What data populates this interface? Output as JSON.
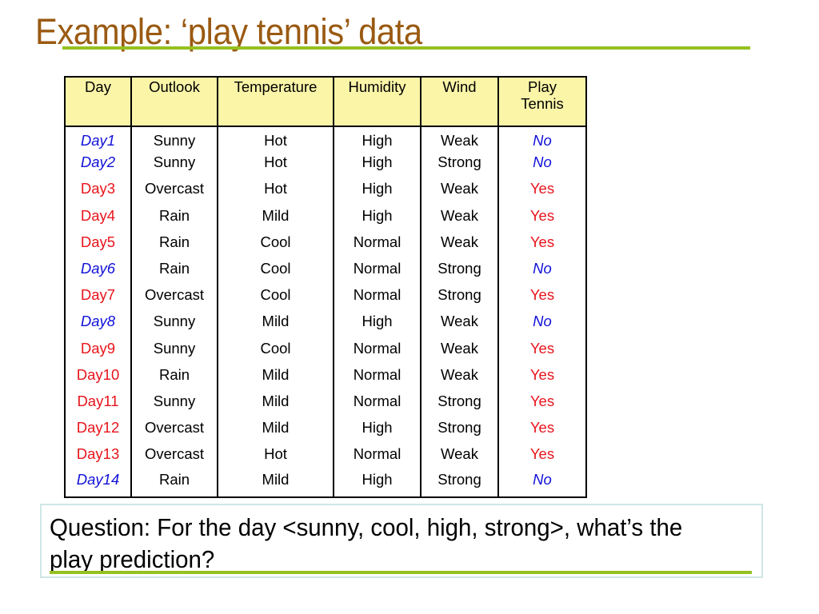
{
  "slide": {
    "title": "Example: ‘play tennis’ data",
    "accent_color": "#94c11f",
    "title_color": "#9a5a12"
  },
  "table": {
    "headers": [
      "Day",
      "Outlook",
      "Temperature",
      "Humidity",
      "Wind",
      "Play Tennis"
    ],
    "header_bg": "#fbf5a8",
    "label_colors": {
      "Yes": "#e8141c",
      "No": "#1010d8"
    },
    "rows": [
      {
        "day": "Day1",
        "outlook": "Sunny",
        "temperature": "Hot",
        "humidity": "High",
        "wind": "Weak",
        "play": "No"
      },
      {
        "day": "Day2",
        "outlook": "Sunny",
        "temperature": "Hot",
        "humidity": "High",
        "wind": "Strong",
        "play": "No"
      },
      {
        "day": "Day3",
        "outlook": "Overcast",
        "temperature": "Hot",
        "humidity": "High",
        "wind": "Weak",
        "play": "Yes"
      },
      {
        "day": "Day4",
        "outlook": "Rain",
        "temperature": "Mild",
        "humidity": "High",
        "wind": "Weak",
        "play": "Yes"
      },
      {
        "day": "Day5",
        "outlook": "Rain",
        "temperature": "Cool",
        "humidity": "Normal",
        "wind": "Weak",
        "play": "Yes"
      },
      {
        "day": "Day6",
        "outlook": "Rain",
        "temperature": "Cool",
        "humidity": "Normal",
        "wind": "Strong",
        "play": "No"
      },
      {
        "day": "Day7",
        "outlook": "Overcast",
        "temperature": "Cool",
        "humidity": "Normal",
        "wind": "Strong",
        "play": "Yes"
      },
      {
        "day": "Day8",
        "outlook": "Sunny",
        "temperature": "Mild",
        "humidity": "High",
        "wind": "Weak",
        "play": "No"
      },
      {
        "day": "Day9",
        "outlook": "Sunny",
        "temperature": "Cool",
        "humidity": "Normal",
        "wind": "Weak",
        "play": "Yes"
      },
      {
        "day": "Day10",
        "outlook": "Rain",
        "temperature": "Mild",
        "humidity": "Normal",
        "wind": "Weak",
        "play": "Yes"
      },
      {
        "day": "Day11",
        "outlook": "Sunny",
        "temperature": "Mild",
        "humidity": "Normal",
        "wind": "Strong",
        "play": "Yes"
      },
      {
        "day": "Day12",
        "outlook": "Overcast",
        "temperature": "Mild",
        "humidity": "High",
        "wind": "Strong",
        "play": "Yes"
      },
      {
        "day": "Day13",
        "outlook": "Overcast",
        "temperature": "Hot",
        "humidity": "Normal",
        "wind": "Weak",
        "play": "Yes"
      },
      {
        "day": "Day14",
        "outlook": "Rain",
        "temperature": "Mild",
        "humidity": "High",
        "wind": "Strong",
        "play": "No"
      }
    ]
  },
  "question": {
    "text": "Question: For the day <sunny, cool, high, strong>, what’s the play prediction?"
  }
}
